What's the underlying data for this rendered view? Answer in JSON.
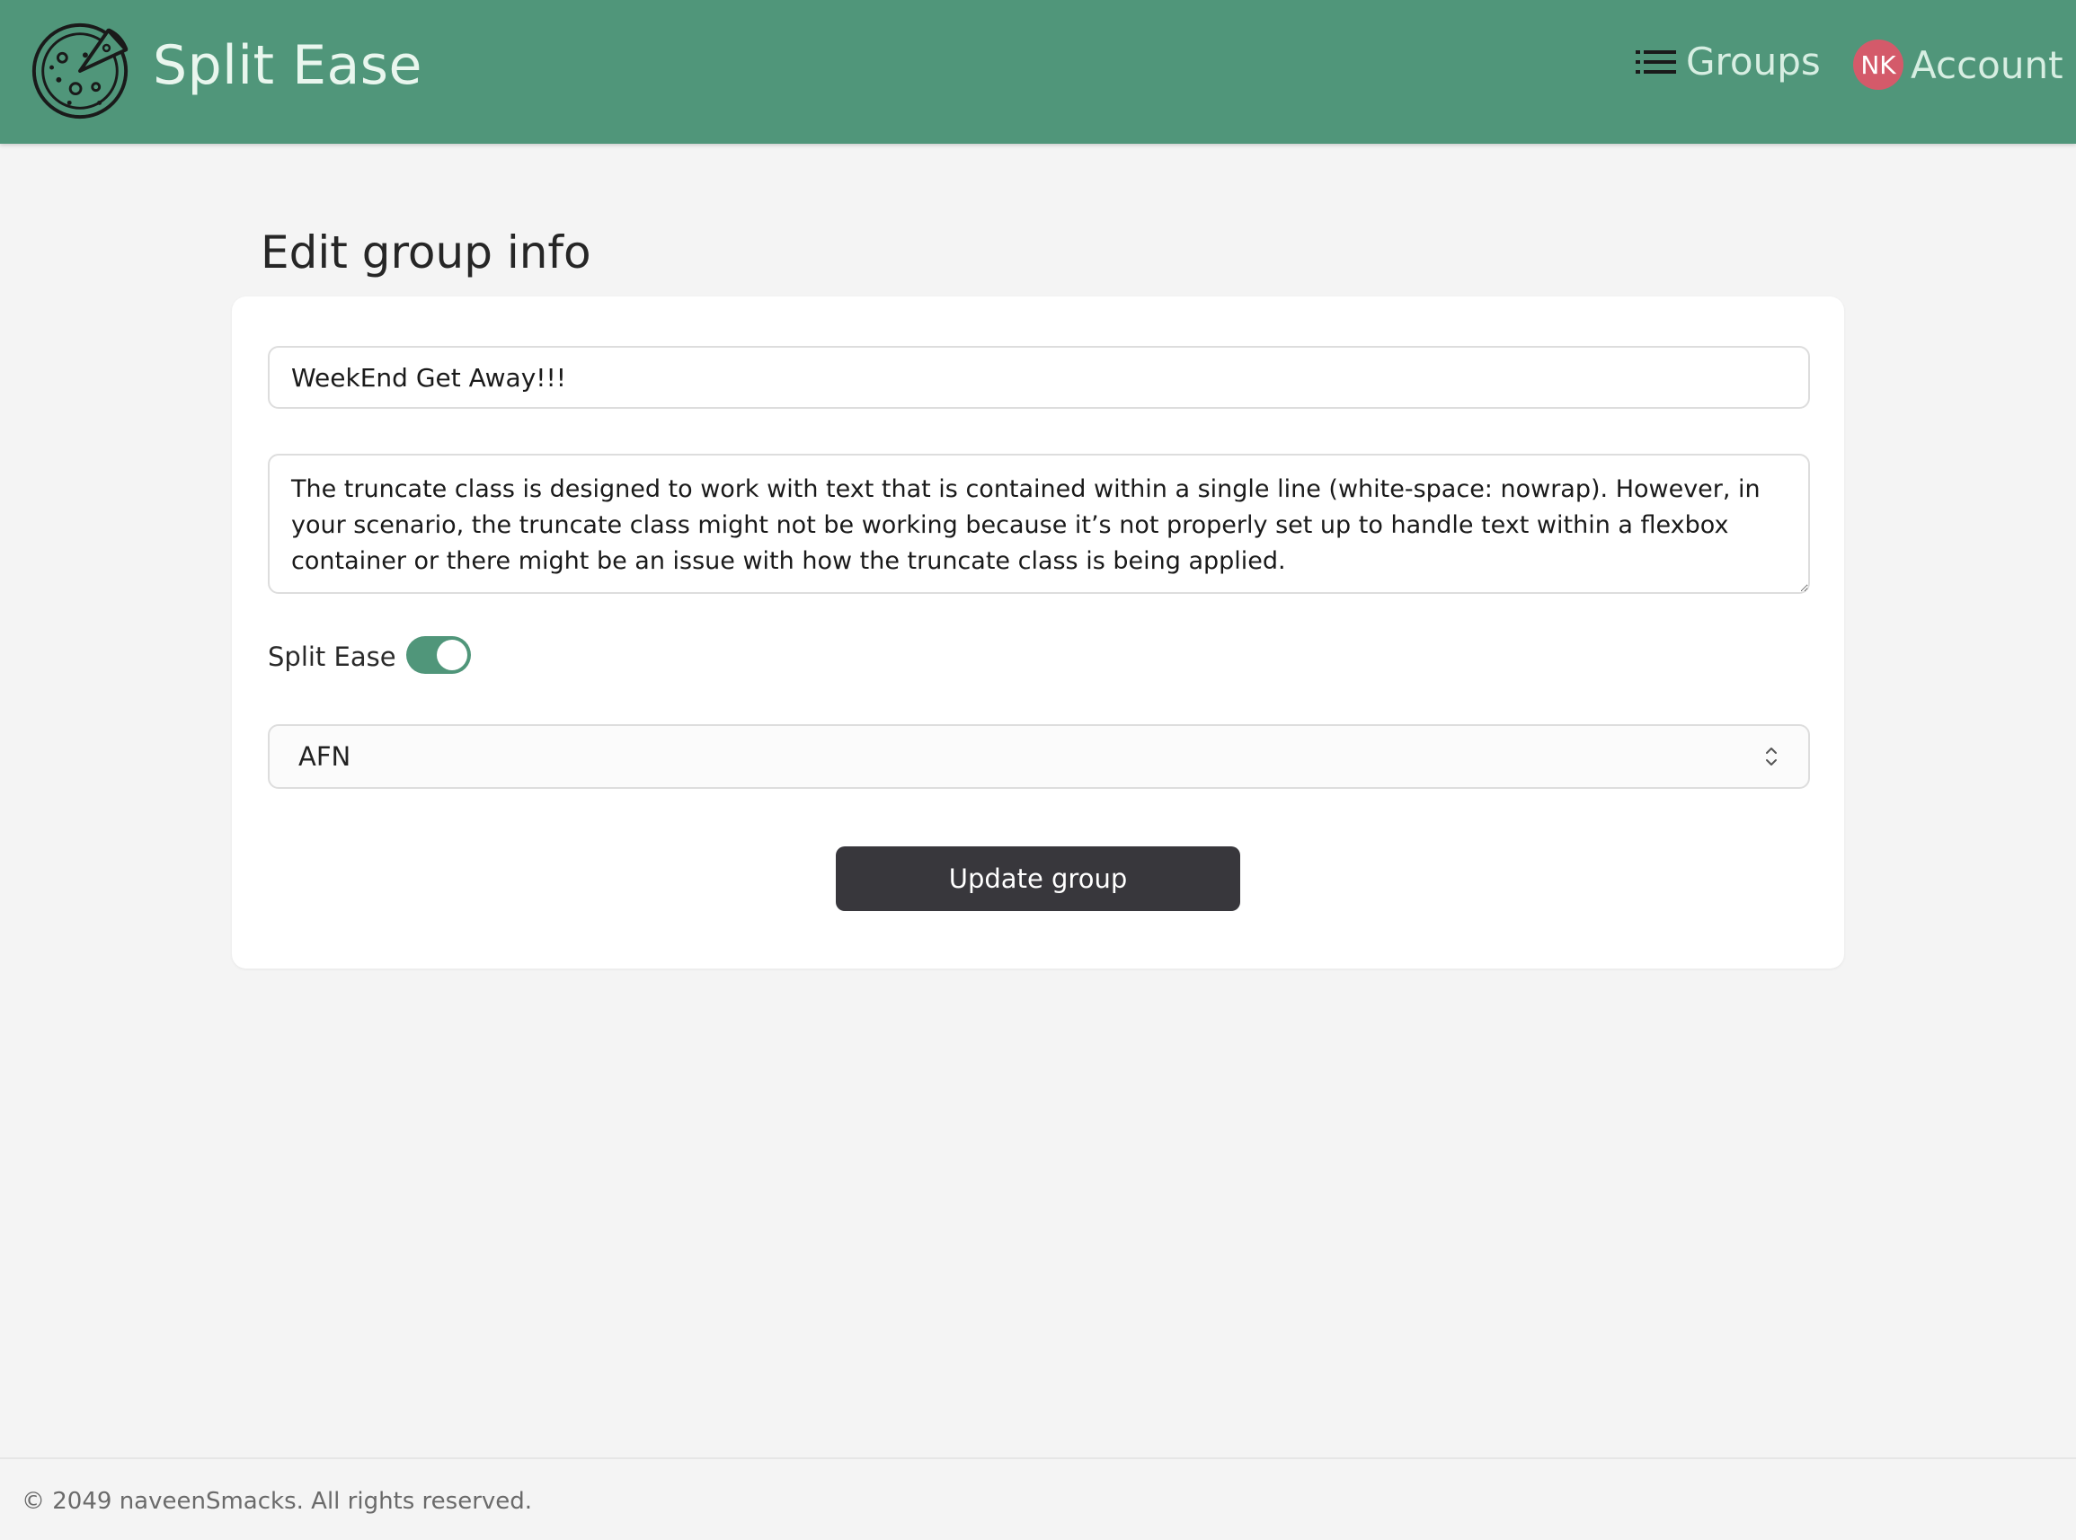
{
  "header": {
    "brand": "Split Ease",
    "nav": {
      "groups_label": "Groups",
      "account_label": "Account",
      "avatar_initials": "NK"
    }
  },
  "page": {
    "title": "Edit group info"
  },
  "form": {
    "group_name": "WeekEnd Get Away!!!",
    "description": "The truncate class is designed to work with text that is contained within a single line (white-space: nowrap). However, in your scenario, the truncate class might not be working because it’s not properly set up to handle text within a flexbox container or there might be an issue with how the truncate class is being applied.",
    "toggle_label": "Split Ease",
    "toggle_on": true,
    "currency": "AFN",
    "submit_label": "Update group"
  },
  "footer": {
    "copyright": "© 2049 naveenSmacks. All rights reserved."
  },
  "colors": {
    "header_bg": "#50967a",
    "toggle_on": "#50967a",
    "button_bg": "#38373c",
    "avatar_bg": "#d45a6a",
    "page_bg": "#f4f4f4"
  },
  "icons": {
    "logo": "pizza-icon",
    "groups": "list-icon",
    "select": "chevron-updown-icon"
  }
}
